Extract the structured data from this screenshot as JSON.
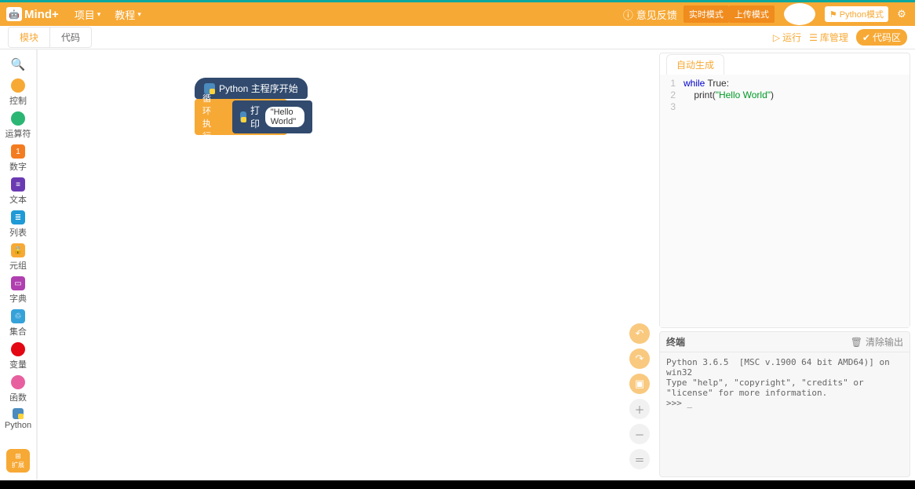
{
  "top": {
    "logo": "Mind+",
    "menu": [
      "项目",
      "教程"
    ],
    "feedback": "意见反馈",
    "modes": {
      "realtime": "实时模式",
      "upload": "上传模式",
      "python": "Python模式"
    }
  },
  "second": {
    "tabs": {
      "blocks": "模块",
      "code": "代码"
    },
    "run": "运行",
    "lib": "库管理",
    "codeArea": "代码区"
  },
  "cats": [
    {
      "name": "控制",
      "color": "#f7a935",
      "shape": "dot"
    },
    {
      "name": "运算符",
      "color": "#2bb673",
      "shape": "dot"
    },
    {
      "name": "数字",
      "color": "#f47c20",
      "shape": "sq",
      "glyph": "1"
    },
    {
      "name": "文本",
      "color": "#6a3ab2",
      "shape": "sq",
      "glyph": "≡"
    },
    {
      "name": "列表",
      "color": "#1e9ad6",
      "shape": "sq",
      "glyph": "≣"
    },
    {
      "name": "元组",
      "color": "#f7a935",
      "shape": "sq",
      "glyph": "🔒"
    },
    {
      "name": "字典",
      "color": "#b03fb0",
      "shape": "sq",
      "glyph": "▭"
    },
    {
      "name": "集合",
      "color": "#35a2d9",
      "shape": "sq",
      "glyph": "♲"
    },
    {
      "name": "变量",
      "color": "#e30613",
      "shape": "dot"
    },
    {
      "name": "函数",
      "color": "#e85fa0",
      "shape": "dot"
    },
    {
      "name": "Python",
      "color": "#4b8bbe",
      "shape": "py"
    }
  ],
  "ext": "扩展",
  "blocks": {
    "hat": "Python 主程序开始",
    "loop": "循环执行",
    "printLabel": "打印",
    "printArg": "\"Hello World\""
  },
  "code": {
    "tab": "自动生成",
    "lines": [
      {
        "n": 1,
        "pre": "",
        "kw": "while",
        "mid": " True",
        "post": ":"
      },
      {
        "n": 2,
        "pre": "    ",
        "fn": "print",
        "mid": "(",
        "str": "\"Hello World\"",
        "post": ")"
      },
      {
        "n": 3
      }
    ]
  },
  "term": {
    "title": "终端",
    "clear": "清除输出",
    "body": "Python 3.6.5  [MSC v.1900 64 bit AMD64)] on win32\nType \"help\", \"copyright\", \"credits\" or \"license\" for more information.\n>>> _"
  }
}
